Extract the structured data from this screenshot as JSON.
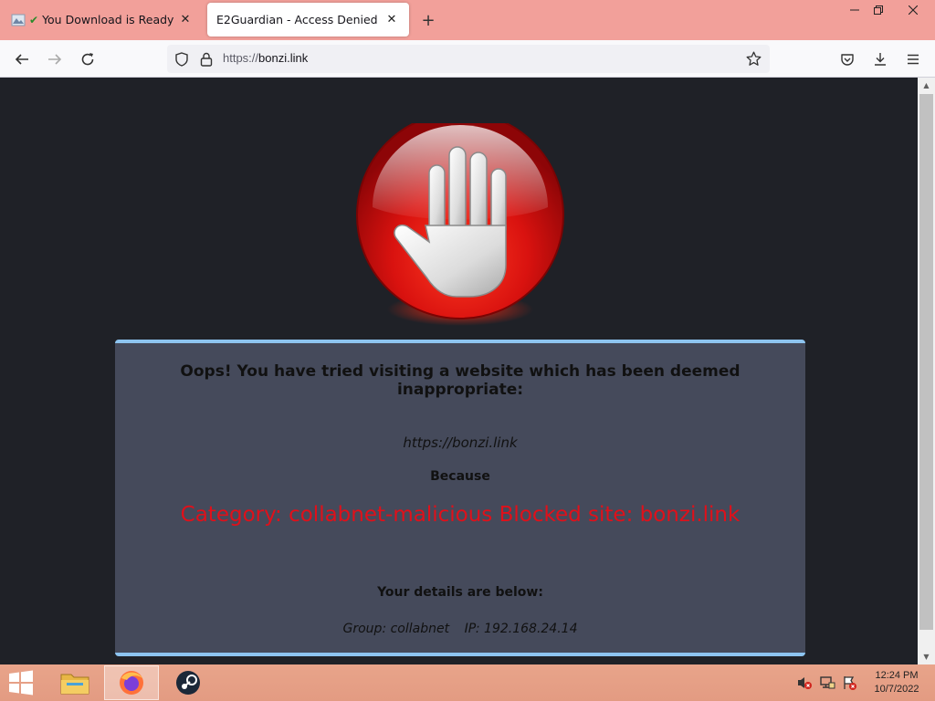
{
  "browser": {
    "tabs": [
      {
        "title": "You Download is Ready",
        "active": false,
        "icon": "site-favicon"
      },
      {
        "title": "E2Guardian - Access Denied",
        "active": true
      }
    ],
    "url_protocol": "https://",
    "url_host": "bonzi.link"
  },
  "page": {
    "headline": "Oops! You have tried visiting a website which has been deemed inappropriate:",
    "blocked_url": "https://bonzi.link",
    "because_label": "Because",
    "reason": "Category: collabnet-malicious  Blocked site: bonzi.link",
    "details_label": "Your details are below:",
    "group": "Group: collabnet",
    "ip": "IP: 192.168.24.14",
    "reason_color": "#e0101a",
    "panel_border_color": "#8dc4f0"
  },
  "taskbar": {
    "apps": [
      "file-explorer-icon",
      "firefox-icon",
      "steam-icon"
    ],
    "time": "12:24 PM",
    "date": "10/7/2022"
  }
}
